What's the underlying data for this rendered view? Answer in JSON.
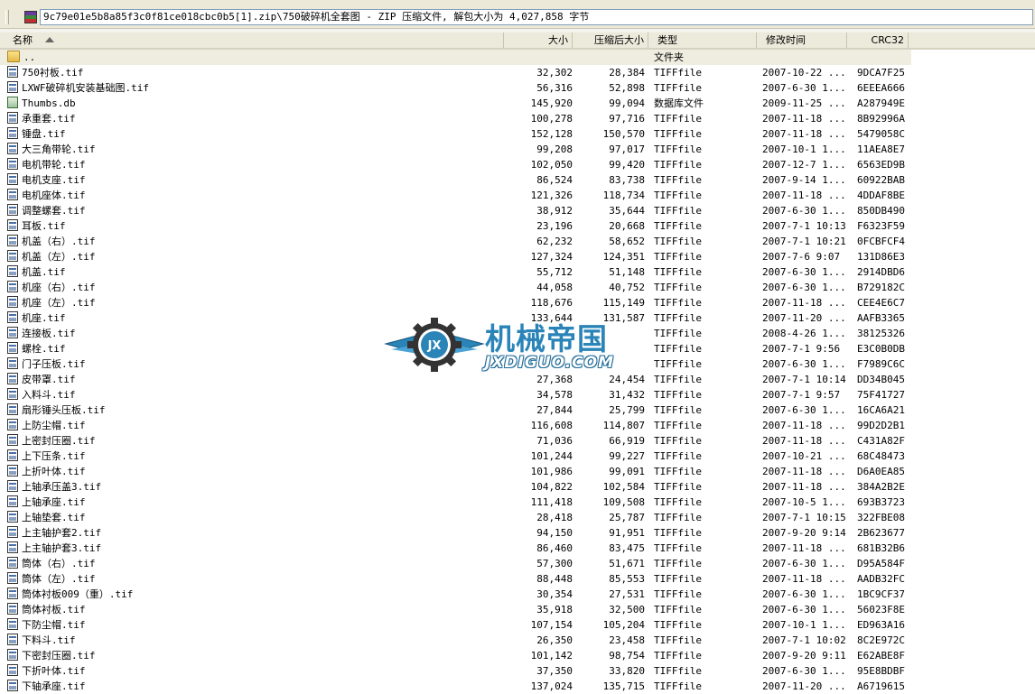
{
  "path": "9c79e01e5b8a85f3c0f81ce018cbc0b5[1].zip\\750破碎机全套图 - ZIP 压缩文件, 解包大小为 4,027,858 字节",
  "columns": {
    "name": "名称",
    "size": "大小",
    "packed": "压缩后大小",
    "type": "类型",
    "modified": "修改时间",
    "crc": "CRC32"
  },
  "updir": {
    "name": "..",
    "type": "文件夹"
  },
  "files": [
    {
      "icon": "tif",
      "name": "750衬板.tif",
      "size": "32,302",
      "packed": "28,384",
      "type": "TIFFfile",
      "modified": "2007-10-22 ...",
      "crc": "9DCA7F25"
    },
    {
      "icon": "tif",
      "name": "LXWF破碎机安装基础图.tif",
      "size": "56,316",
      "packed": "52,898",
      "type": "TIFFfile",
      "modified": "2007-6-30 1...",
      "crc": "6EEEA666"
    },
    {
      "icon": "db",
      "name": "Thumbs.db",
      "size": "145,920",
      "packed": "99,094",
      "type": "数据库文件",
      "modified": "2009-11-25 ...",
      "crc": "A287949E"
    },
    {
      "icon": "tif",
      "name": "承重套.tif",
      "size": "100,278",
      "packed": "97,716",
      "type": "TIFFfile",
      "modified": "2007-11-18 ...",
      "crc": "8B92996A"
    },
    {
      "icon": "tif",
      "name": "锤盘.tif",
      "size": "152,128",
      "packed": "150,570",
      "type": "TIFFfile",
      "modified": "2007-11-18 ...",
      "crc": "5479058C"
    },
    {
      "icon": "tif",
      "name": "大三角带轮.tif",
      "size": "99,208",
      "packed": "97,017",
      "type": "TIFFfile",
      "modified": "2007-10-1 1...",
      "crc": "11AEA8E7"
    },
    {
      "icon": "tif",
      "name": "电机带轮.tif",
      "size": "102,050",
      "packed": "99,420",
      "type": "TIFFfile",
      "modified": "2007-12-7 1...",
      "crc": "6563ED9B"
    },
    {
      "icon": "tif",
      "name": "电机支座.tif",
      "size": "86,524",
      "packed": "83,738",
      "type": "TIFFfile",
      "modified": "2007-9-14 1...",
      "crc": "60922BAB"
    },
    {
      "icon": "tif",
      "name": "电机座体.tif",
      "size": "121,326",
      "packed": "118,734",
      "type": "TIFFfile",
      "modified": "2007-11-18 ...",
      "crc": "4DDAF8BE"
    },
    {
      "icon": "tif",
      "name": "调整螺套.tif",
      "size": "38,912",
      "packed": "35,644",
      "type": "TIFFfile",
      "modified": "2007-6-30 1...",
      "crc": "850DB490"
    },
    {
      "icon": "tif",
      "name": "耳板.tif",
      "size": "23,196",
      "packed": "20,668",
      "type": "TIFFfile",
      "modified": "2007-7-1 10:13",
      "crc": "F6323F59"
    },
    {
      "icon": "tif",
      "name": "机盖（右）.tif",
      "size": "62,232",
      "packed": "58,652",
      "type": "TIFFfile",
      "modified": "2007-7-1 10:21",
      "crc": "0FCBFCF4"
    },
    {
      "icon": "tif",
      "name": "机盖（左）.tif",
      "size": "127,324",
      "packed": "124,351",
      "type": "TIFFfile",
      "modified": "2007-7-6 9:07",
      "crc": "131D86E3"
    },
    {
      "icon": "tif",
      "name": "机盖.tif",
      "size": "55,712",
      "packed": "51,148",
      "type": "TIFFfile",
      "modified": "2007-6-30 1...",
      "crc": "2914DBD6"
    },
    {
      "icon": "tif",
      "name": "机座（右）.tif",
      "size": "44,058",
      "packed": "40,752",
      "type": "TIFFfile",
      "modified": "2007-6-30 1...",
      "crc": "B729182C"
    },
    {
      "icon": "tif",
      "name": "机座（左）.tif",
      "size": "118,676",
      "packed": "115,149",
      "type": "TIFFfile",
      "modified": "2007-11-18 ...",
      "crc": "CEE4E6C7"
    },
    {
      "icon": "tif",
      "name": "机座.tif",
      "size": "133,644",
      "packed": "131,587",
      "type": "TIFFfile",
      "modified": "2007-11-20 ...",
      "crc": "AAFB3365"
    },
    {
      "icon": "tif",
      "name": "连接板.tif",
      "size": "",
      "packed": "",
      "type": "TIFFfile",
      "modified": "2008-4-26 1...",
      "crc": "38125326"
    },
    {
      "icon": "tif",
      "name": "螺栓.tif",
      "size": "",
      "packed": "",
      "type": "TIFFfile",
      "modified": "2007-7-1 9:56",
      "crc": "E3C0B0DB"
    },
    {
      "icon": "tif",
      "name": "门子压板.tif",
      "size": "",
      "packed": "",
      "type": "TIFFfile",
      "modified": "2007-6-30 1...",
      "crc": "F7989C6C"
    },
    {
      "icon": "tif",
      "name": "皮带罩.tif",
      "size": "27,368",
      "packed": "24,454",
      "type": "TIFFfile",
      "modified": "2007-7-1 10:14",
      "crc": "DD34B045"
    },
    {
      "icon": "tif",
      "name": "入料斗.tif",
      "size": "34,578",
      "packed": "31,432",
      "type": "TIFFfile",
      "modified": "2007-7-1 9:57",
      "crc": "75F41727"
    },
    {
      "icon": "tif",
      "name": "扇形锤头压板.tif",
      "size": "27,844",
      "packed": "25,799",
      "type": "TIFFfile",
      "modified": "2007-6-30 1...",
      "crc": "16CA6A21"
    },
    {
      "icon": "tif",
      "name": "上防尘帽.tif",
      "size": "116,608",
      "packed": "114,807",
      "type": "TIFFfile",
      "modified": "2007-11-18 ...",
      "crc": "99D2D2B1"
    },
    {
      "icon": "tif",
      "name": "上密封压圈.tif",
      "size": "71,036",
      "packed": "66,919",
      "type": "TIFFfile",
      "modified": "2007-11-18 ...",
      "crc": "C431A82F"
    },
    {
      "icon": "tif",
      "name": "上下压条.tif",
      "size": "101,244",
      "packed": "99,227",
      "type": "TIFFfile",
      "modified": "2007-10-21 ...",
      "crc": "68C48473"
    },
    {
      "icon": "tif",
      "name": "上折叶体.tif",
      "size": "101,986",
      "packed": "99,091",
      "type": "TIFFfile",
      "modified": "2007-11-18 ...",
      "crc": "D6A0EA85"
    },
    {
      "icon": "tif",
      "name": "上轴承压盖3.tif",
      "size": "104,822",
      "packed": "102,584",
      "type": "TIFFfile",
      "modified": "2007-11-18 ...",
      "crc": "384A2B2E"
    },
    {
      "icon": "tif",
      "name": "上轴承座.tif",
      "size": "111,418",
      "packed": "109,508",
      "type": "TIFFfile",
      "modified": "2007-10-5 1...",
      "crc": "693B3723"
    },
    {
      "icon": "tif",
      "name": "上轴垫套.tif",
      "size": "28,418",
      "packed": "25,787",
      "type": "TIFFfile",
      "modified": "2007-7-1 10:15",
      "crc": "322FBE08"
    },
    {
      "icon": "tif",
      "name": "上主轴护套2.tif",
      "size": "94,150",
      "packed": "91,951",
      "type": "TIFFfile",
      "modified": "2007-9-20 9:14",
      "crc": "2B623677"
    },
    {
      "icon": "tif",
      "name": "上主轴护套3.tif",
      "size": "86,460",
      "packed": "83,475",
      "type": "TIFFfile",
      "modified": "2007-11-18 ...",
      "crc": "681B32B6"
    },
    {
      "icon": "tif",
      "name": "筒体（右）.tif",
      "size": "57,300",
      "packed": "51,671",
      "type": "TIFFfile",
      "modified": "2007-6-30 1...",
      "crc": "D95A584F"
    },
    {
      "icon": "tif",
      "name": "筒体（左）.tif",
      "size": "88,448",
      "packed": "85,553",
      "type": "TIFFfile",
      "modified": "2007-11-18 ...",
      "crc": "AADB32FC"
    },
    {
      "icon": "tif",
      "name": "筒体衬板009（重）.tif",
      "size": "30,354",
      "packed": "27,531",
      "type": "TIFFfile",
      "modified": "2007-6-30 1...",
      "crc": "1BC9CF37"
    },
    {
      "icon": "tif",
      "name": "筒体衬板.tif",
      "size": "35,918",
      "packed": "32,500",
      "type": "TIFFfile",
      "modified": "2007-6-30 1...",
      "crc": "56023F8E"
    },
    {
      "icon": "tif",
      "name": "下防尘帽.tif",
      "size": "107,154",
      "packed": "105,204",
      "type": "TIFFfile",
      "modified": "2007-10-1 1...",
      "crc": "ED963A16"
    },
    {
      "icon": "tif",
      "name": "下料斗.tif",
      "size": "26,350",
      "packed": "23,458",
      "type": "TIFFfile",
      "modified": "2007-7-1 10:02",
      "crc": "8C2E972C"
    },
    {
      "icon": "tif",
      "name": "下密封压圈.tif",
      "size": "101,142",
      "packed": "98,754",
      "type": "TIFFfile",
      "modified": "2007-9-20 9:11",
      "crc": "E62ABE8F"
    },
    {
      "icon": "tif",
      "name": "下折叶体.tif",
      "size": "37,350",
      "packed": "33,820",
      "type": "TIFFfile",
      "modified": "2007-6-30 1...",
      "crc": "95E8BDBF"
    },
    {
      "icon": "tif",
      "name": "下轴承座.tif",
      "size": "137,024",
      "packed": "135,715",
      "type": "TIFFfile",
      "modified": "2007-11-20 ...",
      "crc": "A6719615"
    }
  ],
  "watermark": {
    "title": "机械帝国",
    "domain": "JXDIGUO.COM",
    "badge": "JX"
  }
}
